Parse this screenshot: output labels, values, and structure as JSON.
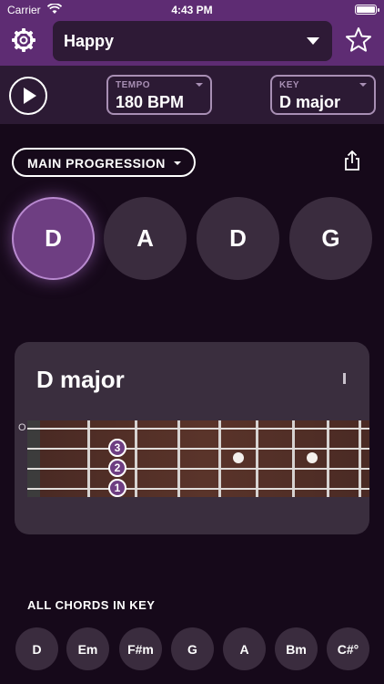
{
  "status": {
    "carrier": "Carrier",
    "time": "4:43 PM"
  },
  "header": {
    "song": "Happy"
  },
  "controls": {
    "tempo_label": "TEMPO",
    "tempo_value": "180 BPM",
    "key_label": "KEY",
    "key_value": "D major"
  },
  "progression": {
    "label": "MAIN PROGRESSION",
    "chords": [
      "D",
      "A",
      "D",
      "G"
    ],
    "active_index": 0
  },
  "chord_card": {
    "title": "D major",
    "mark": "I",
    "open_label": "O",
    "fingers": [
      "3",
      "2",
      "1"
    ]
  },
  "key_chords": {
    "title": "ALL CHORDS IN KEY",
    "chords": [
      "D",
      "Em",
      "F#m",
      "G",
      "A",
      "Bm",
      "C#°"
    ]
  },
  "colors": {
    "header": "#5e2c73",
    "active_chord": "#6e3e82",
    "background": "#16091a"
  }
}
